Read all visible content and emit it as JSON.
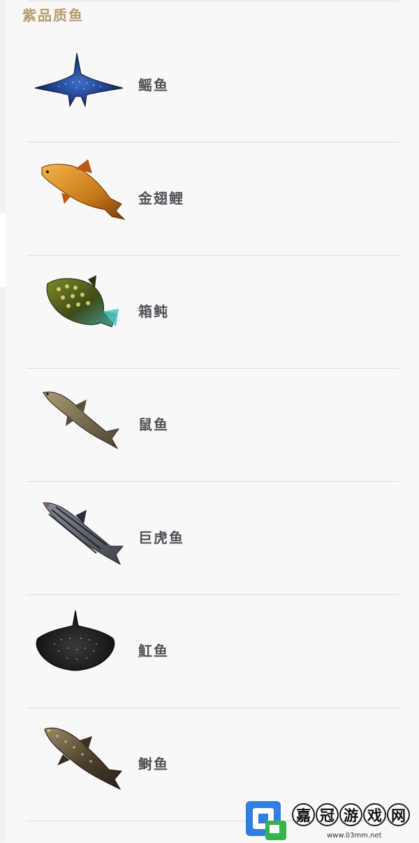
{
  "section": {
    "title": "紫品质鱼"
  },
  "fish": [
    {
      "name": "鳐鱼",
      "icon": "manta-ray-icon"
    },
    {
      "name": "金翅鲤",
      "icon": "golden-carp-icon"
    },
    {
      "name": "箱鲀",
      "icon": "boxfish-icon"
    },
    {
      "name": "鼠鱼",
      "icon": "mouse-fish-icon"
    },
    {
      "name": "巨虎鱼",
      "icon": "tiger-fish-icon"
    },
    {
      "name": "魟鱼",
      "icon": "stingray-icon"
    },
    {
      "name": "鲥鱼",
      "icon": "shad-fish-icon"
    }
  ],
  "watermark": {
    "chars": [
      "嘉",
      "冠",
      "游",
      "戏",
      "网"
    ],
    "url": "www.03mm.net",
    "colors": {
      "logo_blue": "#2f7fe0",
      "logo_green": "#36b34a"
    }
  },
  "colors": {
    "title": "#b6996b",
    "fish_name": "#4f5056",
    "divider": "#dedede"
  }
}
